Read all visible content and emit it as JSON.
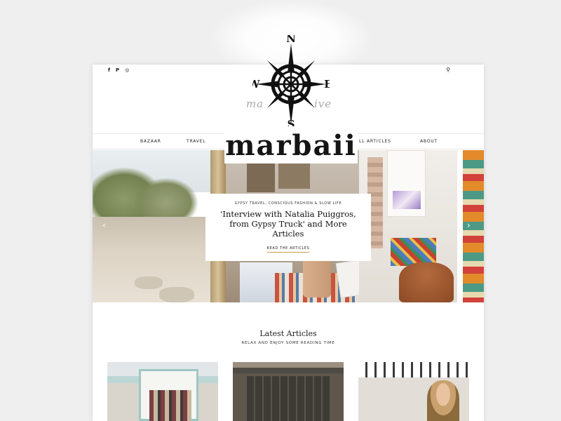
{
  "header": {
    "social_icons": [
      "facebook-icon",
      "pinterest-icon",
      "instagram-icon"
    ],
    "social_glyphs": [
      "f",
      "P",
      "◎"
    ],
    "search_glyph": "⚲",
    "tagline": "ma",
    "tagline_end": "ive"
  },
  "logo": {
    "compass_letters": {
      "n": "N",
      "s": "S",
      "e": "E",
      "w": "W"
    },
    "wordmark": "marbaii"
  },
  "nav": {
    "items": [
      "BAZAAR",
      "TRAVEL",
      "LL ARTICLES",
      "ABOUT"
    ]
  },
  "hero": {
    "category": "GYPSY TRAVEL, CONSCIOUS FASHION & SLOW LIFE",
    "title": "'Interview with Natalia Puiggros, from Gypsy Truck' and More Articles",
    "link": "READ THE ARTICLES",
    "prev_arrow": "‹",
    "next_arrow": "›",
    "accent_color": "#c8a04e"
  },
  "latest": {
    "title": "Latest Articles",
    "subtitle": "RELAX AND ENJOY SOME READING TIME"
  }
}
